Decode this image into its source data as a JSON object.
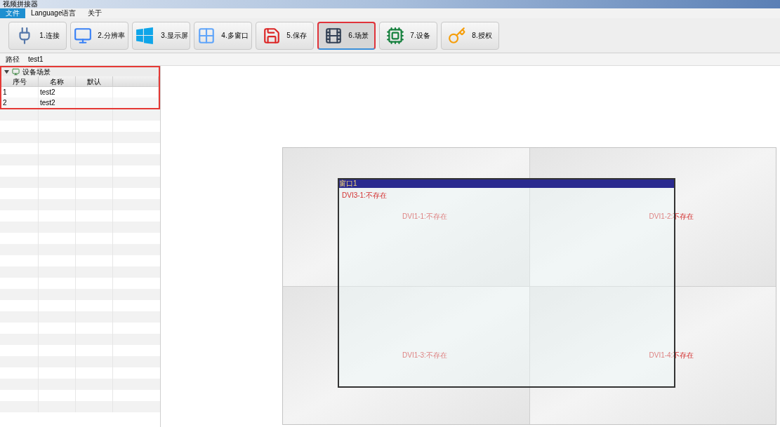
{
  "window": {
    "title": "视频拼接器"
  },
  "menu": [
    {
      "label": "文件",
      "selected": true
    },
    {
      "label": "Language语言",
      "selected": false
    },
    {
      "label": "关于",
      "selected": false
    }
  ],
  "toolbar": [
    {
      "kind": "connect",
      "label": "1.连接",
      "selected": false
    },
    {
      "kind": "resolution",
      "label": "2.分辨率",
      "selected": false
    },
    {
      "kind": "display",
      "label": "3.显示屏",
      "selected": false
    },
    {
      "kind": "multiwindow",
      "label": "4.多窗口",
      "selected": false
    },
    {
      "kind": "save",
      "label": "5.保存",
      "selected": false
    },
    {
      "kind": "scene",
      "label": "6.场景",
      "selected": true
    },
    {
      "kind": "device",
      "label": "7.设备",
      "selected": false
    },
    {
      "kind": "license",
      "label": "8.授权",
      "selected": false
    }
  ],
  "path": {
    "label": "路径",
    "value": "test1"
  },
  "scene_tree": {
    "title": "设备场景",
    "expanded": true,
    "highlighted": true,
    "columns": [
      "序号",
      "名称",
      "默认"
    ],
    "rows": [
      {
        "cells": [
          "1",
          "test2",
          ""
        ]
      },
      {
        "cells": [
          "2",
          "test2",
          ""
        ]
      }
    ]
  },
  "video_wall": {
    "screens": [
      "DVI1-1:不存在",
      "DVI1-2:不存在",
      "DVI1-3:不存在",
      "DVI1-4:不存在"
    ],
    "windows": [
      {
        "title": "窗口1",
        "source": "DVI3-1:不存在"
      }
    ]
  }
}
